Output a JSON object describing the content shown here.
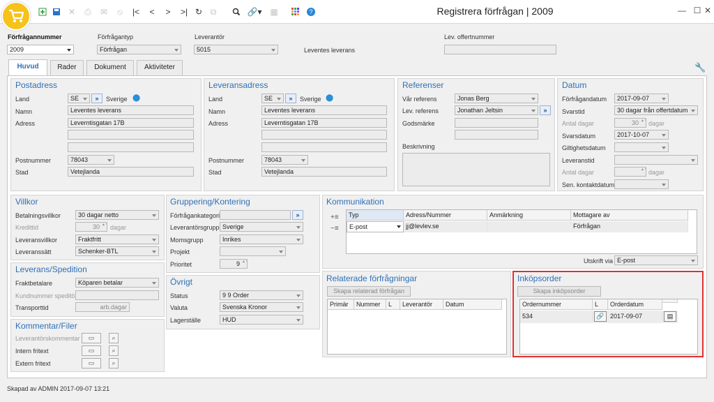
{
  "window": {
    "title": "Registrera förfrågan | 2009"
  },
  "header": {
    "request_number_label": "Förfrågannummer",
    "request_number": "2009",
    "request_type_label": "Förfrågantyp",
    "request_type": "Förfrågan",
    "supplier_label": "Leverantör",
    "supplier": "5015",
    "supplier_name": "Leventes leverans",
    "offer_number_label": "Lev. offertnummer",
    "offer_number": ""
  },
  "tabs": [
    "Huvud",
    "Rader",
    "Dokument",
    "Aktiviteter"
  ],
  "postal": {
    "title": "Postadress",
    "land_label": "Land",
    "land_code": "SE",
    "land_name": "Sverige",
    "name_label": "Namn",
    "name": "Leventes leverans",
    "address_label": "Adress",
    "address1": "Leverntisgatan 17B",
    "address2": "",
    "address3": "",
    "zip_label": "Postnummer",
    "zip": "78043",
    "city_label": "Stad",
    "city": "Vetejlanda"
  },
  "delivery": {
    "title": "Leveransadress",
    "land_label": "Land",
    "land_code": "SE",
    "land_name": "Sverige",
    "name_label": "Namn",
    "name": "Leventes leverans",
    "address_label": "Adress",
    "address1": "Leverntisgatan 17B",
    "address2": "",
    "address3": "",
    "zip_label": "Postnummer",
    "zip": "78043",
    "city_label": "Stad",
    "city": "Vetejlanda"
  },
  "refs": {
    "title": "Referenser",
    "our_ref_label": "Vår referens",
    "our_ref": "Jonas Berg",
    "sup_ref_label": "Lev. referens",
    "sup_ref": "Jonathan Jeltsin",
    "goods_label": "Godsmärke",
    "goods": "",
    "desc_label": "Beskrivning"
  },
  "dates": {
    "title": "Datum",
    "req_date_label": "Förfrågandatum",
    "req_date": "2017-09-07",
    "reply_label": "Svarstid",
    "reply": "30 dagar från offertdatum",
    "days_label": "Antal dagar",
    "days": "30",
    "days_unit": "dagar",
    "reply_date_label": "Svarsdatum",
    "reply_date": "2017-10-07",
    "valid_label": "Giltighetsdatum",
    "valid": "",
    "lead_label": "Leveranstid",
    "lead": "",
    "lead_days_label": "Antal dagar",
    "lead_days": "",
    "lead_days_unit": "dagar",
    "contact_label": "Sen. kontaktdatum",
    "contact": ""
  },
  "terms": {
    "title": "Villkor",
    "payment_label": "Betalningsvillkor",
    "payment": "30 dagar netto",
    "credit_label": "Kredittid",
    "credit": "30",
    "credit_unit": "dagar",
    "del_terms_label": "Leveransvillkor",
    "del_terms": "Fraktfritt",
    "del_method_label": "Leveranssätt",
    "del_method": "Schenker-BTL"
  },
  "shipping": {
    "title": "Leverans/Spedition",
    "freight_label": "Fraktbetalare",
    "freight": "Köparen betalar",
    "forwarder_label": "Kundnummer speditör",
    "forwarder": "",
    "transit_label": "Transporttid",
    "transit": "arb.dagar"
  },
  "comments": {
    "title": "Kommentar/Filer",
    "supplier_label": "Leverantörskommentar",
    "internal_label": "Intern fritext",
    "external_label": "Extern fritext"
  },
  "grouping": {
    "title": "Gruppering/Kontering",
    "category_label": "Förfrågankategori",
    "category": "",
    "group_label": "Leverantörsgrupp",
    "group": "Sverige",
    "vat_label": "Momsgrupp",
    "vat": "Inrikes",
    "project_label": "Projekt",
    "project": "",
    "priority_label": "Prioritet",
    "priority": "9"
  },
  "other": {
    "title": "Övrigt",
    "status_label": "Status",
    "status": "9  9 Order",
    "currency_label": "Valuta",
    "currency": "Svenska Kronor",
    "warehouse_label": "Lagerställe",
    "warehouse": "HUD"
  },
  "comm": {
    "title": "Kommunikation",
    "cols": [
      "Typ",
      "Adress/Nummer",
      "Anmärkning",
      "Mottagare av"
    ],
    "row": [
      "E-post",
      "jj@levlev.se",
      "",
      "Förfrågan"
    ],
    "output_label": "Utskrift via",
    "output": "E-post"
  },
  "related": {
    "title": "Relaterade förfrågningar",
    "create": "Skapa relaterad förfrågan",
    "cols": [
      "Primär",
      "Nummer",
      "L",
      "Leverantör",
      "Datum"
    ]
  },
  "purchase": {
    "title": "Inköpsorder",
    "create": "Skapa inköpsorder",
    "cols": [
      "Ordernummer",
      "L",
      "Orderdatum"
    ],
    "row": [
      "534",
      "",
      "2017-09-07"
    ]
  },
  "status": {
    "text": "Skapad av ADMIN 2017-09-07 13:21"
  },
  "colors": {
    "accent": "#2e6fb6",
    "highlight": "#e03030",
    "logo": "#f7c21a"
  }
}
